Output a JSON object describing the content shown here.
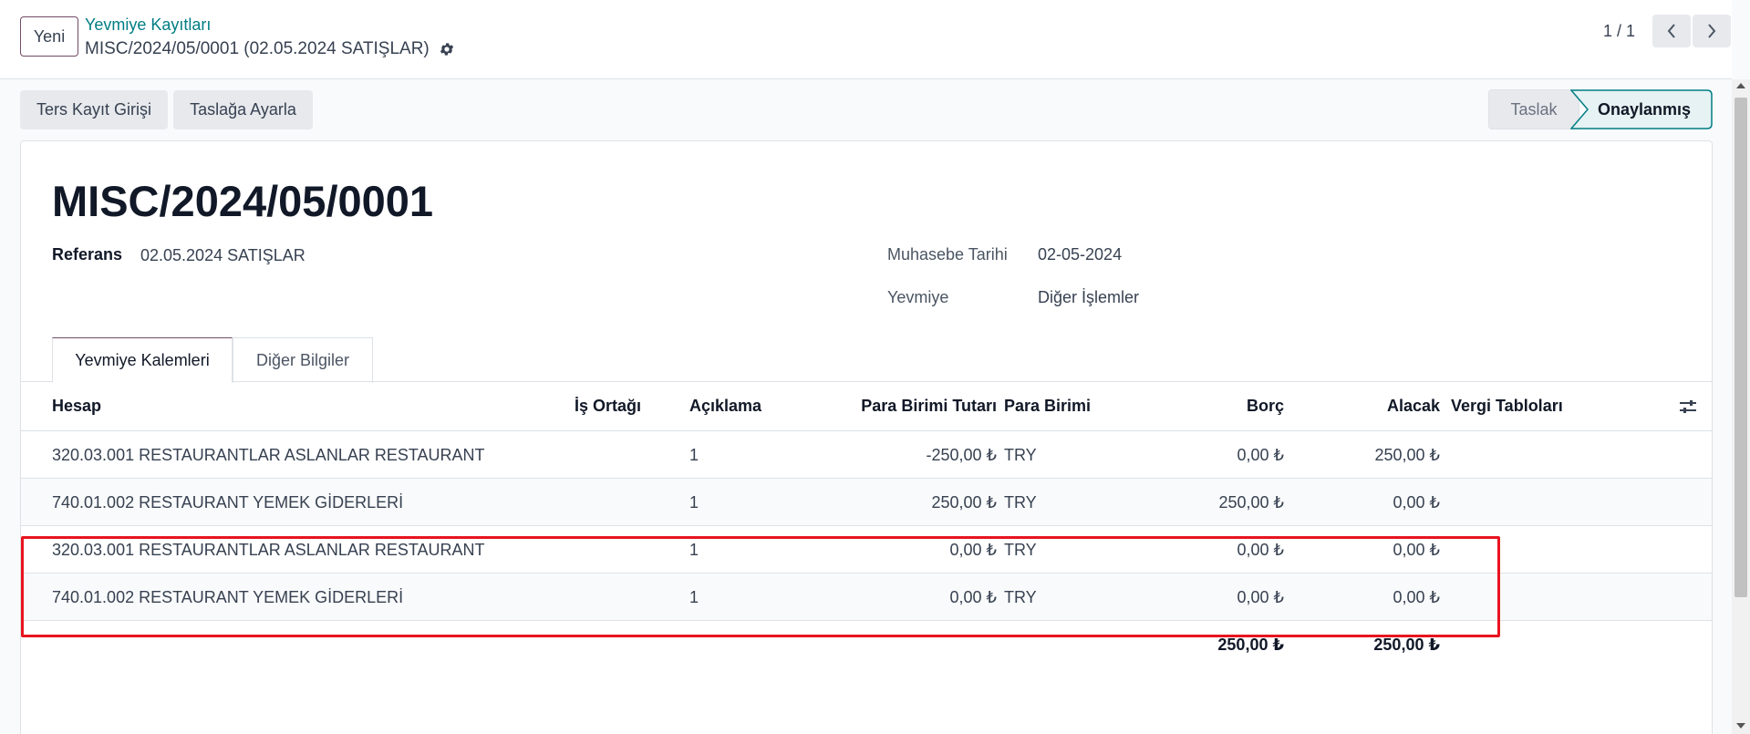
{
  "header": {
    "new_button": "Yeni",
    "breadcrumb_parent": "Yevmiye Kayıtları",
    "breadcrumb_current": "MISC/2024/05/0001 (02.05.2024 SATIŞLAR)",
    "pager": "1 / 1"
  },
  "actions": {
    "reverse_entry": "Ters Kayıt Girişi",
    "reset_to_draft": "Taslağa Ayarla"
  },
  "statusbar": {
    "draft": "Taslak",
    "posted": "Onaylanmış",
    "active": "posted"
  },
  "form": {
    "title": "MISC/2024/05/0001",
    "reference_label": "Referans",
    "reference_value": "02.05.2024 SATIŞLAR",
    "accounting_date_label": "Muhasebe Tarihi",
    "accounting_date_value": "02-05-2024",
    "journal_label": "Yevmiye",
    "journal_value": "Diğer İşlemler"
  },
  "tabs": [
    "Yevmiye Kalemleri",
    "Diğer Bilgiler"
  ],
  "table": {
    "columns": {
      "account": "Hesap",
      "partner": "İş Ortağı",
      "label": "Açıklama",
      "amount_currency": "Para Birimi Tutarı",
      "currency": "Para Birimi",
      "debit": "Borç",
      "credit": "Alacak",
      "tax_grids": "Vergi Tabloları"
    },
    "rows": [
      {
        "account": "320.03.001 RESTAURANTLAR ASLANLAR RESTAURANT",
        "partner": "",
        "label": "1",
        "amount_currency": "-250,00 ₺",
        "currency": "TRY",
        "debit": "0,00 ₺",
        "credit": "250,00 ₺",
        "tax_grids": ""
      },
      {
        "account": "740.01.002 RESTAURANT YEMEK GİDERLERİ",
        "partner": "",
        "label": "1",
        "amount_currency": "250,00 ₺",
        "currency": "TRY",
        "debit": "250,00 ₺",
        "credit": "0,00 ₺",
        "tax_grids": ""
      },
      {
        "account": "320.03.001 RESTAURANTLAR ASLANLAR RESTAURANT",
        "partner": "",
        "label": "1",
        "amount_currency": "0,00 ₺",
        "currency": "TRY",
        "debit": "0,00 ₺",
        "credit": "0,00 ₺",
        "tax_grids": ""
      },
      {
        "account": "740.01.002 RESTAURANT YEMEK GİDERLERİ",
        "partner": "",
        "label": "1",
        "amount_currency": "0,00 ₺",
        "currency": "TRY",
        "debit": "0,00 ₺",
        "credit": "0,00 ₺",
        "tax_grids": ""
      }
    ],
    "totals": {
      "debit": "250,00 ₺",
      "credit": "250,00 ₺"
    }
  },
  "icons": {
    "settings": "gear-icon",
    "pager_prev": "chevron-left-icon",
    "pager_next": "chevron-right-icon",
    "optional_columns": "sliders-icon"
  },
  "colors": {
    "brand": "#714b67",
    "link": "#017e84",
    "annotation": "#e8141f"
  }
}
